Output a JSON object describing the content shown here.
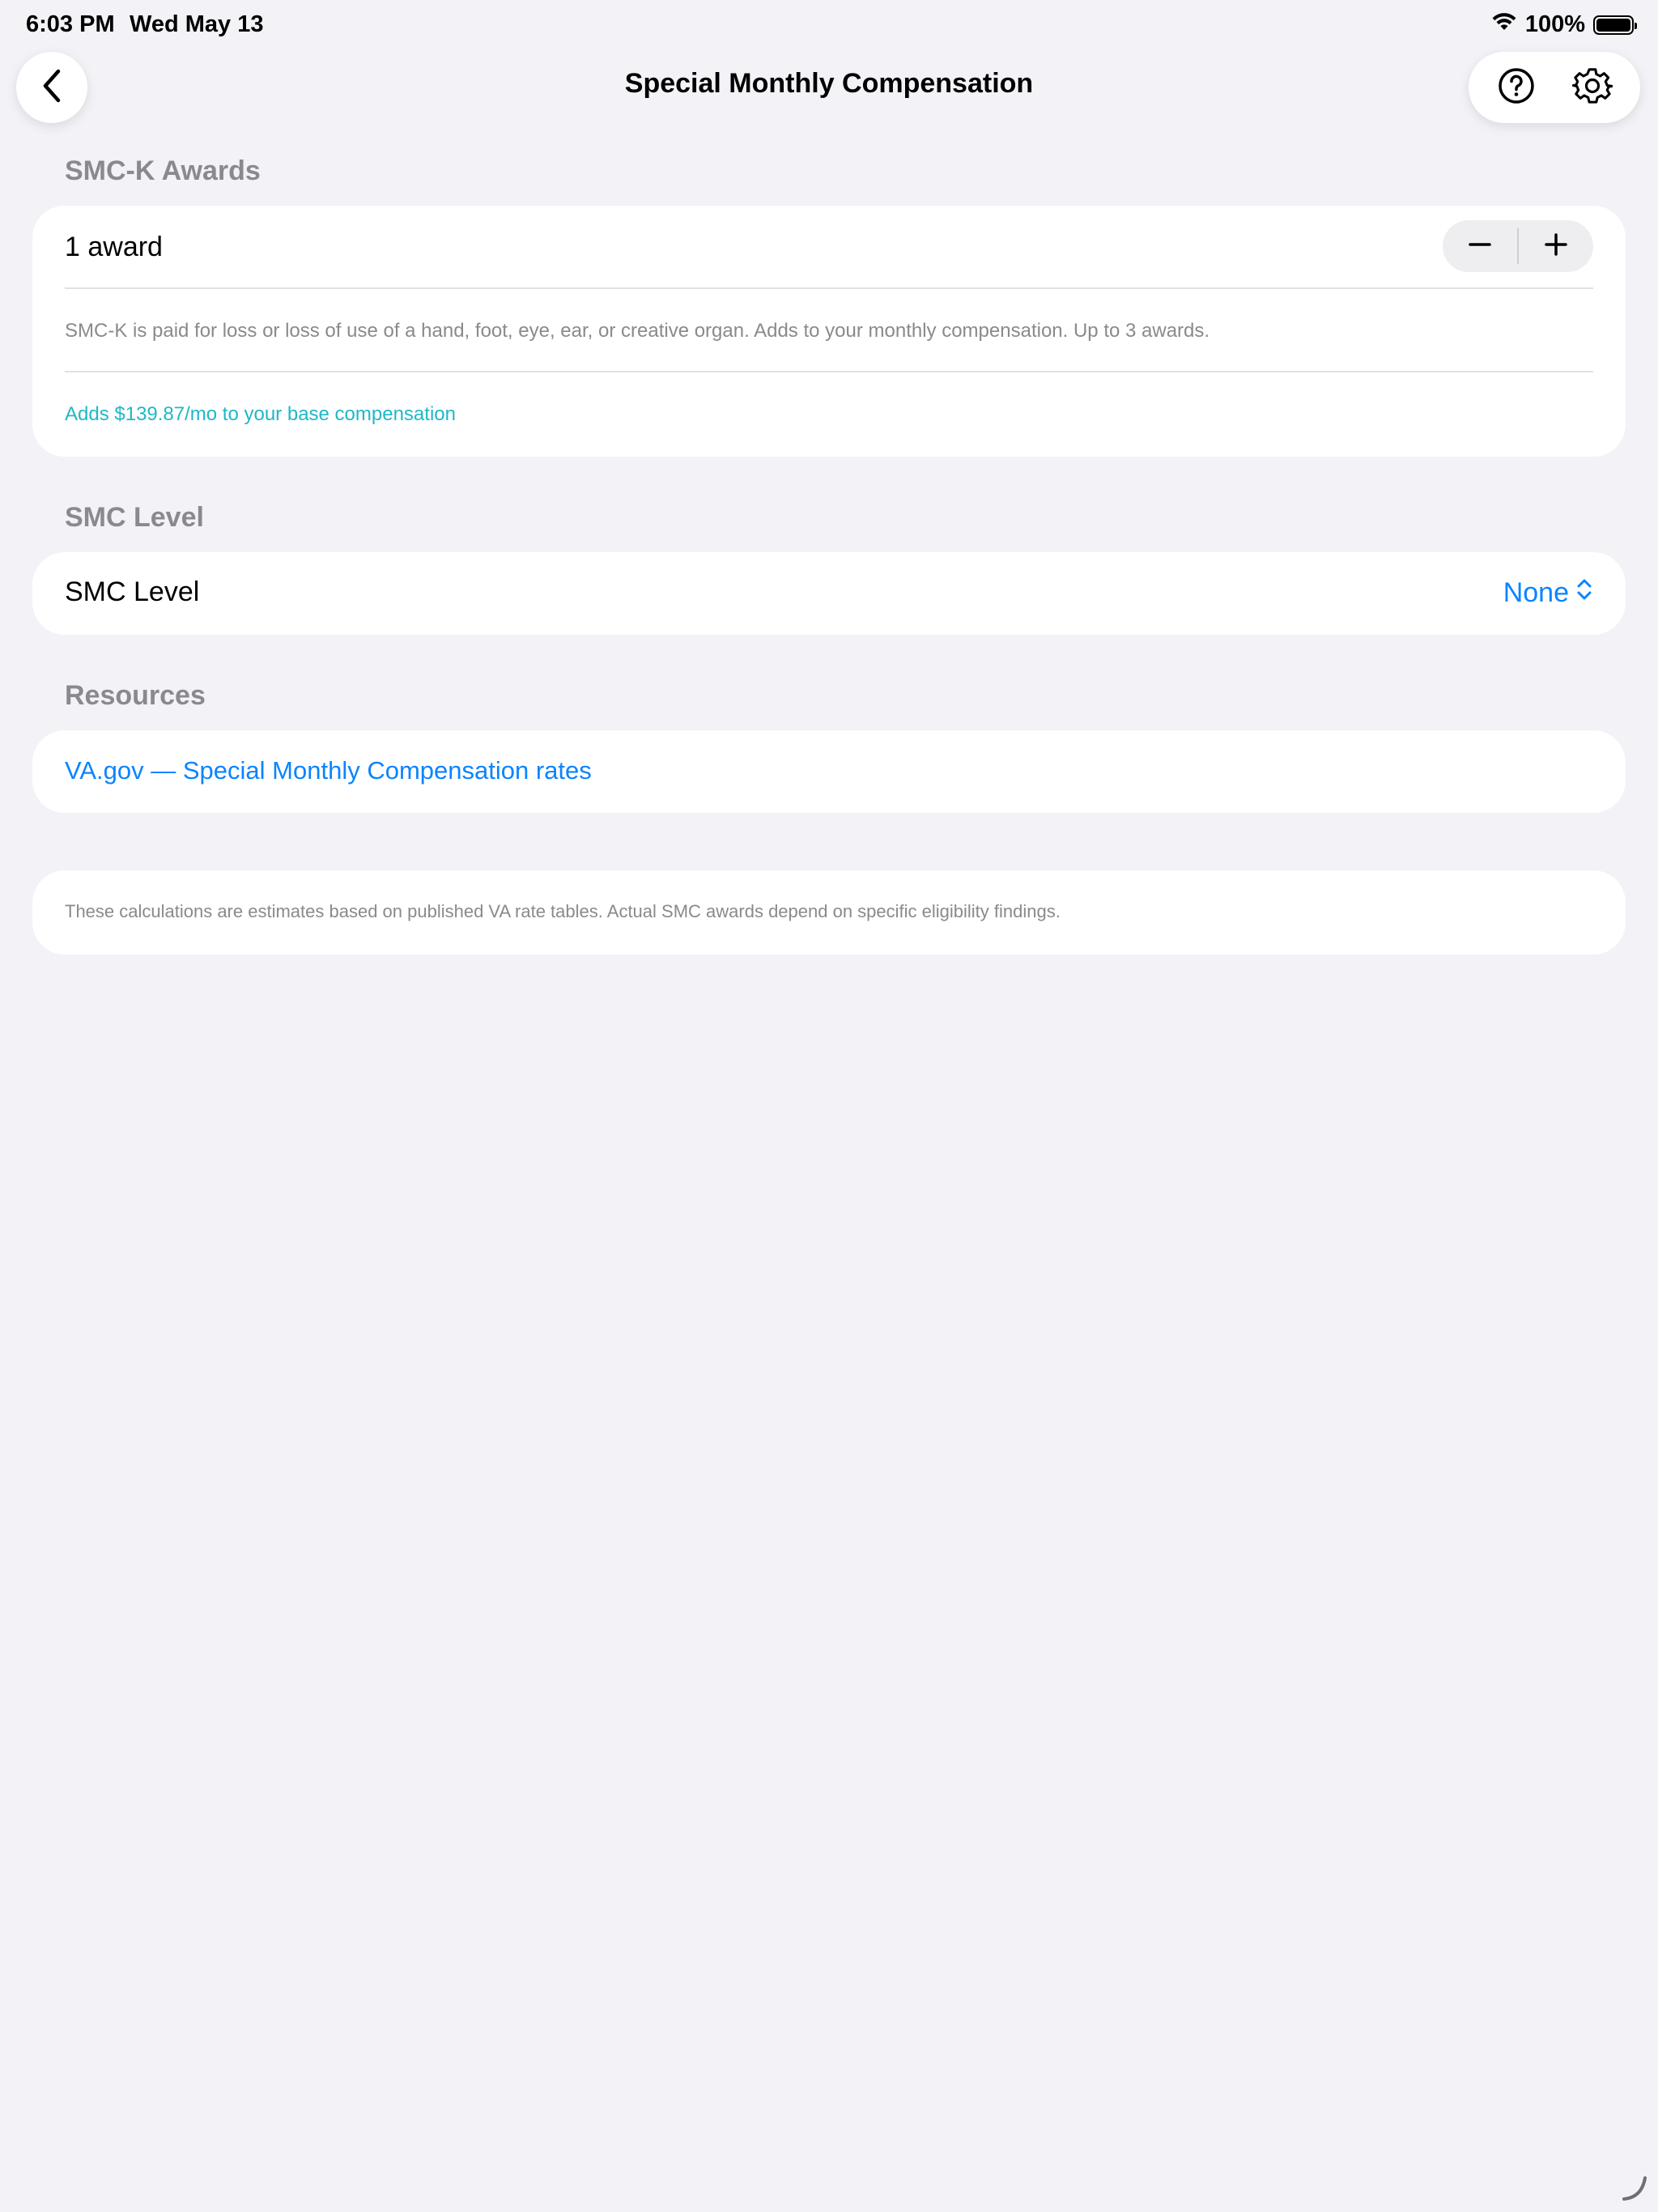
{
  "status_bar": {
    "time": "6:03 PM",
    "date": "Wed May 13",
    "battery": "100%",
    "wifi_icon": "wifi-icon",
    "battery_icon": "battery-icon"
  },
  "nav": {
    "title": "Special Monthly Compensation",
    "back_icon": "chevron-left-icon",
    "help_icon": "question-circle-icon",
    "settings_icon": "gear-icon"
  },
  "smck": {
    "header": "SMC-K Awards",
    "count_label": "1 award",
    "description": "SMC-K is paid for loss or loss of use of a hand, foot, eye, ear, or creative organ. Adds to your monthly compensation. Up to 3 awards.",
    "adds_text": "Adds $139.87/mo to your base compensation",
    "stepper": {
      "minus_icon": "minus-icon",
      "plus_icon": "plus-icon"
    }
  },
  "smc_level": {
    "header": "SMC Level",
    "label": "SMC Level",
    "value": "None",
    "picker_icon": "chevron-up-down-icon"
  },
  "resources": {
    "header": "Resources",
    "link": "VA.gov — Special Monthly Compensation rates"
  },
  "disclaimer": "These calculations are estimates based on published VA rate tables. Actual SMC awards depend on specific eligibility findings.",
  "colors": {
    "background": "#f2f2f7",
    "accent_blue": "#0a84ff",
    "accent_teal": "#1eb8c8",
    "secondary_gray": "#8a8a8e"
  }
}
